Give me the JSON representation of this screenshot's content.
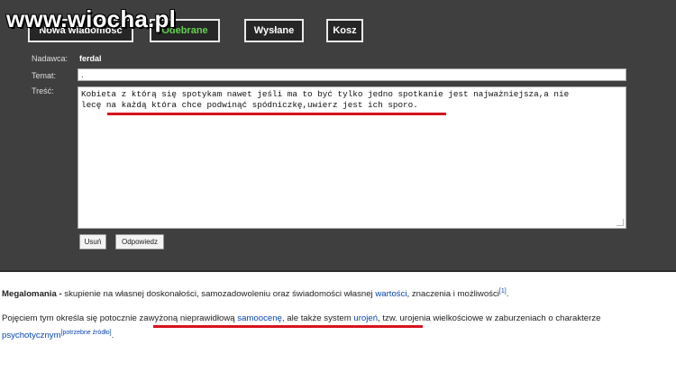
{
  "watermark": "www.wiocha.pl",
  "tabs": {
    "new": "Nowa wiadomość",
    "received": "Odebrane",
    "sent": "Wysłane",
    "trash": "Kosz"
  },
  "message": {
    "sender_label": "Nadawca:",
    "sender": "ferdal",
    "subject_label": "Temat:",
    "subject": ".",
    "body_label": "Treść:",
    "body_line1": "Kobieta z którą się spotykam nawet jeśli ma to być tylko jedno spotkanie jest najważniejsza,a nie",
    "body_line2": "lecę na każdą która chce podwinąć spódniczkę,uwierz jest ich sporo."
  },
  "buttons": {
    "delete": "Usuń",
    "reply": "Odpowiedz"
  },
  "wiki": {
    "term": "Megalomania -",
    "p1_text1": " skupienie na własnej doskonałości, samozadowoleniu oraz świadomości własnej ",
    "p1_link": "wartości",
    "p1_text2": ", znaczenia i możliwości",
    "p1_ref": "[1]",
    "p1_end": ".",
    "p2_text1": "Pojęciem tym określa się potocznie zawyżoną nieprawidłową ",
    "p2_link1": "samoocenę",
    "p2_text2": ", ale także system ",
    "p2_link2": "urojeń",
    "p2_text3": ", tzw. urojenia wielkościowe w zaburzeniach o charakterze",
    "p3_link": "psychotycznym",
    "p3_ref": "[potrzebne źródło]",
    "p3_end": "."
  }
}
